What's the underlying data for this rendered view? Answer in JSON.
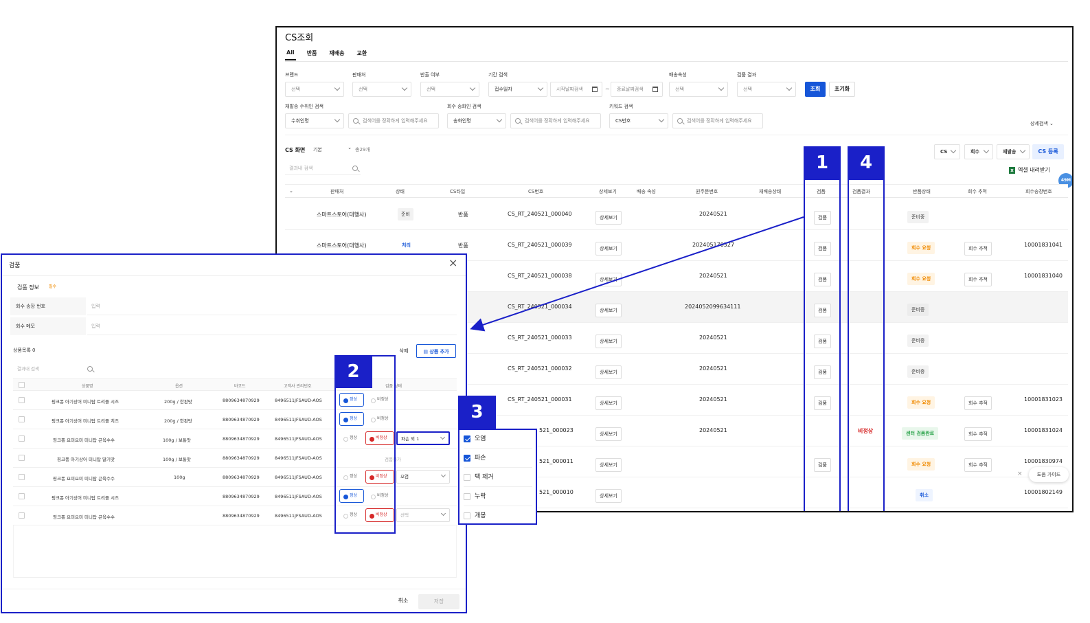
{
  "main": {
    "title": "CS조회",
    "tabs": [
      "All",
      "반품",
      "재배송",
      "교환"
    ],
    "filters": {
      "row1_labels": [
        "브랜드",
        "판매처",
        "반출 여부",
        "기간 검색",
        "배송속성",
        "검품 결과"
      ],
      "row1_values": [
        "선택",
        "선택",
        "선택",
        "접수일자",
        "선택",
        "선택"
      ],
      "date_start_placeholder": "시작날짜검색",
      "date_tilde": "~",
      "date_end_placeholder": "종료날짜검색",
      "search_button": "조회",
      "reset_button": "초기화",
      "row2_labels": [
        "재발송 수취인 검색",
        "회수 송화인 검색",
        "키워드 검색"
      ],
      "row2_selects": [
        "수취인명",
        "송화인명",
        "CS번호"
      ],
      "row2_placeholders": [
        "검색어를 정확하게 입력해주세요",
        "검색어를 정확하게 입력해주세요",
        "검색어를 정확하게 입력해주세요"
      ],
      "advanced_search": "상세검색"
    },
    "grid_toolbar": {
      "screen_label": "CS 화면",
      "view_select": "기본",
      "total": "총29개",
      "result_search_placeholder": "결과내 검색",
      "selects": [
        "CS",
        "회수",
        "재발송"
      ],
      "register_button": "CS 등록",
      "excel_button": "엑셀 내려받기",
      "floating_badge": "49M"
    },
    "columns": [
      "판매처",
      "상태",
      "CS타입",
      "CS번호",
      "상세보기",
      "배송 속성",
      "원주문번호",
      "재배송상태",
      "검품",
      "검품결과",
      "반품상태",
      "회수 추적",
      "회수송장번호"
    ],
    "rows": [
      {
        "seller": "스마트스토어(대행사)",
        "status": "준비",
        "type": "반품",
        "cs_no": "CS_RT_240521_000040",
        "detail": "상세보기",
        "order_no": "20240521",
        "inspect": "검품",
        "result": "",
        "return_status": "준비중",
        "track": "",
        "invoice": ""
      },
      {
        "seller": "스마트스토어(대행사)",
        "status": "처리",
        "type": "반품",
        "cs_no": "CS_RT_240521_000039",
        "detail": "상세보기",
        "order_no": "202405170527",
        "inspect": "검품",
        "result": "",
        "return_status": "회수 요청",
        "track": "회수 추적",
        "invoice": "10001831041"
      },
      {
        "seller": "",
        "status": "",
        "type": "",
        "cs_no": "CS_RT_240521_000038",
        "detail": "상세보기",
        "order_no": "20240521",
        "inspect": "검품",
        "result": "",
        "return_status": "회수 요청",
        "track": "회수 추적",
        "invoice": "10001831040"
      },
      {
        "seller": "",
        "status": "",
        "type": "",
        "cs_no": "CS_RT_240521_000034",
        "detail": "상세보기",
        "order_no": "2024052099634111",
        "inspect": "검품",
        "result": "",
        "return_status": "준비중",
        "track": "",
        "invoice": ""
      },
      {
        "seller": "",
        "status": "",
        "type": "",
        "cs_no": "CS_RT_240521_000033",
        "detail": "상세보기",
        "order_no": "20240521",
        "inspect": "검품",
        "result": "",
        "return_status": "준비중",
        "track": "",
        "invoice": ""
      },
      {
        "seller": "",
        "status": "",
        "type": "",
        "cs_no": "CS_RT_240521_000032",
        "detail": "상세보기",
        "order_no": "20240521",
        "inspect": "검품",
        "result": "",
        "return_status": "준비중",
        "track": "",
        "invoice": ""
      },
      {
        "seller": "",
        "status": "",
        "type": "",
        "cs_no": "CS_RT_240521_000031",
        "detail": "상세보기",
        "order_no": "20240521",
        "inspect": "검품",
        "result": "",
        "return_status": "회수 요청",
        "track": "회수 추적",
        "invoice": "10001831023"
      },
      {
        "seller": "",
        "status": "",
        "type": "",
        "cs_no": "521_000023",
        "detail": "상세보기",
        "order_no": "20240521",
        "inspect": "",
        "result": "비정상",
        "return_status": "센터 검품완료",
        "track": "회수 추적",
        "invoice": "10001831024"
      },
      {
        "seller": "",
        "status": "",
        "type": "",
        "cs_no": "521_000011",
        "detail": "상세보기",
        "order_no": "",
        "inspect": "검품",
        "result": "",
        "return_status": "회수 요청",
        "track": "회수 추적",
        "invoice": "10001830974"
      },
      {
        "seller": "",
        "status": "",
        "type": "",
        "cs_no": "521_000010",
        "detail": "상세보기",
        "order_no": "",
        "inspect": "",
        "result": "",
        "return_status": "취소",
        "track": "",
        "invoice": "10001802149"
      }
    ],
    "help_guide": "도움 가이드",
    "annotations": [
      "1",
      "4"
    ]
  },
  "dialog": {
    "title": "검품",
    "section_label": "검품 정보",
    "section_tag": "필수",
    "field_labels": [
      "회수 송장 번호",
      "회수 메모"
    ],
    "field_placeholders": [
      "입력",
      "입력"
    ],
    "product_count_label": "상품목록 0",
    "delete_button": "삭제",
    "add_button": "상품 추가",
    "result_search_placeholder": "결과내 검색",
    "columns": [
      "상품명",
      "옵션",
      "바코드",
      "고객사 관리번호",
      "검품 상태"
    ],
    "radio_labels": [
      "정상",
      "비정상"
    ],
    "rows": [
      {
        "name": "핑크퐁 아기상어 미니탑 트리플 시즈",
        "option": "200g / 한판맛",
        "barcode": "8809634870929",
        "code": "8496511JFSAUD-AOS",
        "state": "normal",
        "reason": ""
      },
      {
        "name": "핑크퐁 아기상어 미니탑 트리플 치즈",
        "option": "200g / 한판맛",
        "barcode": "8809634870929",
        "code": "8496511JFSAUD-AOS",
        "state": "normal",
        "reason": ""
      },
      {
        "name": "핑크퐁 요미요미 미니탑 곤육수수",
        "option": "100g / 보통맛",
        "barcode": "8809634870929",
        "code": "8496511JFSAUD-AOS",
        "state": "abnormal",
        "reason": "파손 외 1"
      },
      {
        "name": "핑크퐁 아기상어 미니탑 딸기맛",
        "option": "100g / 보통맛",
        "barcode": "8809634870929",
        "code": "8496511JFSAUD-AOS",
        "state": "none",
        "reason": "",
        "note": "검품불가"
      },
      {
        "name": "핑크퐁 요미요미 미니탑 곤육수수",
        "option": "100g",
        "barcode": "8809634870929",
        "code": "8496511JFSAUD-AOS",
        "state": "abnormal",
        "reason": "오염"
      },
      {
        "name": "핑크퐁 아기상어 미니탑 트리플 시즈",
        "option": "",
        "barcode": "8809634870929",
        "code": "8496511JFSAUD-AOS",
        "state": "normal",
        "reason": ""
      },
      {
        "name": "핑크퐁 요미요미 미니탑 곤육수수",
        "option": "",
        "barcode": "8809634870929",
        "code": "8496511JFSAUD-AOS",
        "state": "abnormal",
        "reason": "선택"
      }
    ],
    "cancel_button": "취소",
    "save_button": "저장",
    "annotation": "2"
  },
  "dropdown": {
    "annotation": "3",
    "items": [
      {
        "label": "오염",
        "checked": true
      },
      {
        "label": "파손",
        "checked": true
      },
      {
        "label": "택 제거",
        "checked": false
      },
      {
        "label": "누락",
        "checked": false
      },
      {
        "label": "개봉",
        "checked": false
      }
    ]
  },
  "colors": {
    "accent_blue": "#1656d8",
    "annotation_blue": "#1a20c8",
    "status_orange": "#f08a00",
    "status_green": "#2aa34a",
    "status_red": "#d62828"
  }
}
